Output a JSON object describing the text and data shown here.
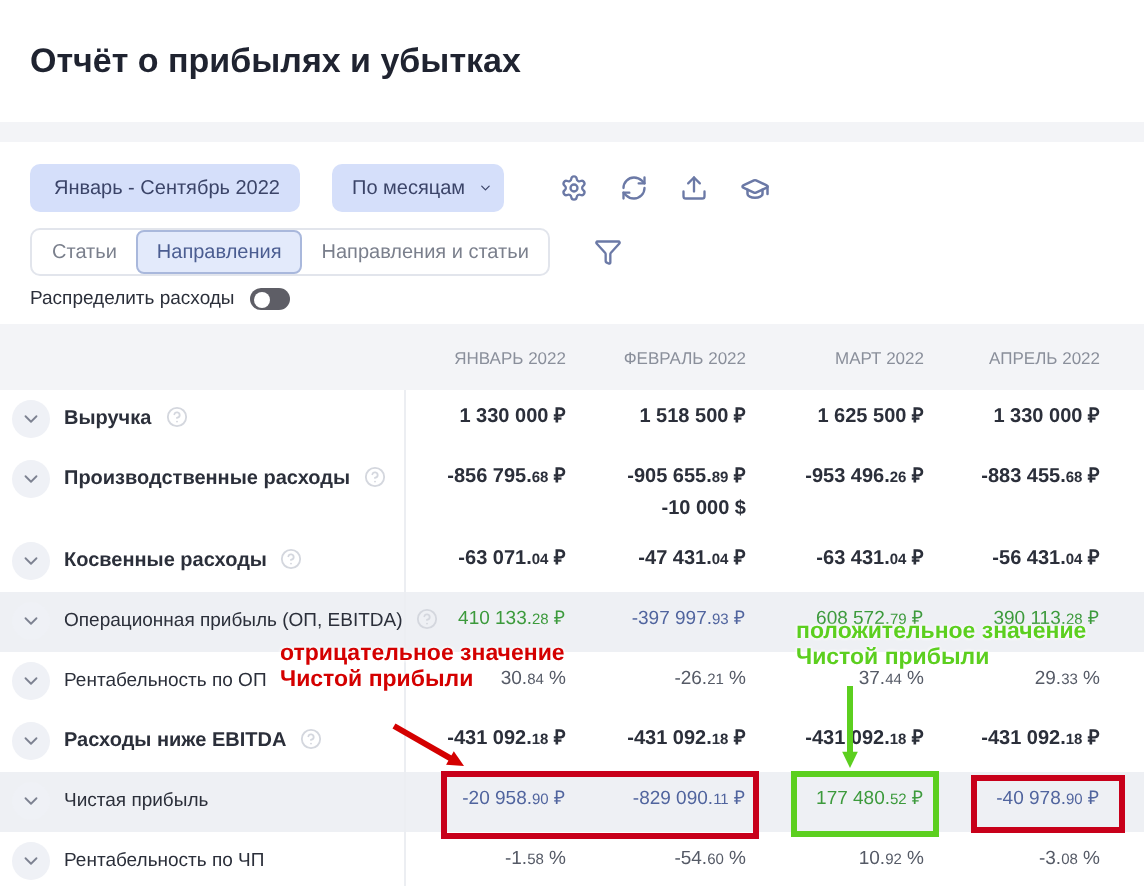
{
  "header": {
    "title": "Отчёт о прибылях и убытках"
  },
  "toolbar": {
    "period": "Январь - Сентябрь 2022",
    "grouping": "По месяцам"
  },
  "tabs": [
    {
      "label": "Статьи",
      "selected": false
    },
    {
      "label": "Направления",
      "selected": true
    },
    {
      "label": "Направления и статьи",
      "selected": false
    }
  ],
  "toggle": {
    "label": "Распределить расходы",
    "on": false
  },
  "table": {
    "columns": [
      "ЯНВАРЬ 2022",
      "ФЕВРАЛЬ 2022",
      "МАРТ 2022",
      "АПРЕЛЬ 2022"
    ],
    "rows": [
      {
        "label": "Выручка",
        "bold": true,
        "help": true,
        "shaded": false,
        "cells": [
          {
            "value": "1 330 000",
            "unit": "₽",
            "kind": "neutral"
          },
          {
            "value": "1 518 500",
            "unit": "₽",
            "kind": "neutral"
          },
          {
            "value": "1 625 500",
            "unit": "₽",
            "kind": "neutral"
          },
          {
            "value": "1 330 000",
            "unit": "₽",
            "kind": "neutral"
          }
        ]
      },
      {
        "label": "Производственные расходы",
        "bold": true,
        "help": true,
        "shaded": false,
        "cells": [
          {
            "value": "-856 795.",
            "decimals": "68",
            "unit": "₽",
            "kind": "neutral"
          },
          {
            "value": "-905 655.",
            "decimals": "89",
            "unit": "₽",
            "kind": "neutral",
            "extra": "-10 000 $"
          },
          {
            "value": "-953 496.",
            "decimals": "26",
            "unit": "₽",
            "kind": "neutral"
          },
          {
            "value": "-883 455.",
            "decimals": "68",
            "unit": "₽",
            "kind": "neutral"
          }
        ]
      },
      {
        "label": "Косвенные расходы",
        "bold": true,
        "help": true,
        "shaded": false,
        "cells": [
          {
            "value": "-63 071.",
            "decimals": "04",
            "unit": "₽",
            "kind": "neutral"
          },
          {
            "value": "-47 431.",
            "decimals": "04",
            "unit": "₽",
            "kind": "neutral"
          },
          {
            "value": "-63 431.",
            "decimals": "04",
            "unit": "₽",
            "kind": "neutral"
          },
          {
            "value": "-56 431.",
            "decimals": "04",
            "unit": "₽",
            "kind": "neutral"
          }
        ]
      },
      {
        "label": "Операционная прибыль (ОП, EBITDA)",
        "bold": false,
        "help": true,
        "shaded": true,
        "cells": [
          {
            "value": "410 133.",
            "decimals": "28",
            "unit": "₽",
            "kind": "positive"
          },
          {
            "value": "-397 997.",
            "decimals": "93",
            "unit": "₽",
            "kind": "negative"
          },
          {
            "value": "608 572.",
            "decimals": "79",
            "unit": "₽",
            "kind": "positive"
          },
          {
            "value": "390 113.",
            "decimals": "28",
            "unit": "₽",
            "kind": "positive"
          }
        ]
      },
      {
        "label": "Рентабельность по ОП",
        "bold": false,
        "help": false,
        "shaded": false,
        "cells": [
          {
            "value": "30.",
            "decimals": "84",
            "unit": "%",
            "kind": "muted"
          },
          {
            "value": "-26.",
            "decimals": "21",
            "unit": "%",
            "kind": "muted"
          },
          {
            "value": "37.",
            "decimals": "44",
            "unit": "%",
            "kind": "muted"
          },
          {
            "value": "29.",
            "decimals": "33",
            "unit": "%",
            "kind": "muted"
          }
        ]
      },
      {
        "label": "Расходы ниже EBITDA",
        "bold": true,
        "help": true,
        "shaded": false,
        "cells": [
          {
            "value": "-431 092.",
            "decimals": "18",
            "unit": "₽",
            "kind": "neutral"
          },
          {
            "value": "-431 092.",
            "decimals": "18",
            "unit": "₽",
            "kind": "neutral"
          },
          {
            "value": "-431 092.",
            "decimals": "18",
            "unit": "₽",
            "kind": "neutral"
          },
          {
            "value": "-431 092.",
            "decimals": "18",
            "unit": "₽",
            "kind": "neutral"
          }
        ]
      },
      {
        "label": "Чистая прибыль",
        "bold": false,
        "help": false,
        "shaded": true,
        "cells": [
          {
            "value": "-20 958.",
            "decimals": "90",
            "unit": "₽",
            "kind": "negative"
          },
          {
            "value": "-829 090.",
            "decimals": "11",
            "unit": "₽",
            "kind": "negative"
          },
          {
            "value": "177 480.",
            "decimals": "52",
            "unit": "₽",
            "kind": "positive"
          },
          {
            "value": "-40 978.",
            "decimals": "90",
            "unit": "₽",
            "kind": "negative"
          }
        ]
      },
      {
        "label": "Рентабельность по ЧП",
        "bold": false,
        "help": false,
        "shaded": false,
        "cells": [
          {
            "value": "-1.",
            "decimals": "58",
            "unit": "%",
            "kind": "muted"
          },
          {
            "value": "-54.",
            "decimals": "60",
            "unit": "%",
            "kind": "muted"
          },
          {
            "value": "10.",
            "decimals": "92",
            "unit": "%",
            "kind": "muted"
          },
          {
            "value": "-3.",
            "decimals": "08",
            "unit": "%",
            "kind": "muted"
          }
        ]
      }
    ]
  },
  "annotations": [
    {
      "kind": "note",
      "lines": [
        "отрицательное значение",
        "Чистой прибыли"
      ],
      "color": "#d40000"
    },
    {
      "kind": "note",
      "lines": [
        "положительное значение",
        "Чистой прибыли"
      ],
      "color": "#5ccf1f"
    },
    {
      "kind": "arrow",
      "color": "#d40000"
    },
    {
      "kind": "arrow",
      "color": "#5ccf1f"
    },
    {
      "kind": "box",
      "color": "#c8001a"
    },
    {
      "kind": "box",
      "color": "#5ccf1f"
    },
    {
      "kind": "box",
      "color": "#c8001a"
    }
  ]
}
